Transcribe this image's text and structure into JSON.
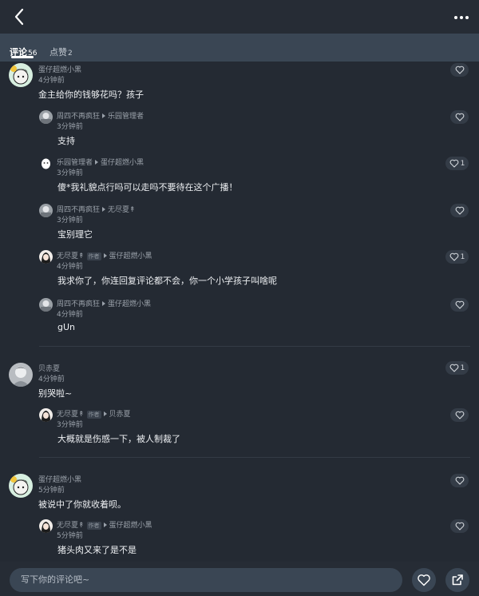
{
  "colors": {
    "background": "#242a33",
    "tab_bar": "#3a4654",
    "text_primary": "#eef0f3",
    "text_secondary": "#9aa1aa"
  },
  "header": {
    "back_icon": "chevron-left-icon",
    "more_icon": "more-dots-icon"
  },
  "tabs": [
    {
      "label": "评论",
      "count": "56",
      "active": true
    },
    {
      "label": "点赞",
      "count": "2",
      "active": false
    }
  ],
  "comments": [
    {
      "name": "蛋仔超燃小黑",
      "time": "4分钟前",
      "text": "金主给你的钱够花吗？孩子",
      "likes": ""
    },
    {
      "name": "周四不再疯狂",
      "target": "乐园管理者",
      "time": "3分钟前",
      "text": "支持",
      "likes": ""
    },
    {
      "name": "乐园管理者",
      "target": "蛋仔超燃小黑",
      "time": "3分钟前",
      "text": "傻*我礼貌点行吗可以走吗不要待在这个广播！",
      "likes": "1"
    },
    {
      "name": "周四不再疯狂",
      "target": "无尽夏↟",
      "time": "3分钟前",
      "text": "宝别理它",
      "likes": ""
    },
    {
      "name": "无尽夏↟",
      "badge": "作者",
      "target": "蛋仔超燃小黑",
      "time": "4分钟前",
      "text": "我求你了，你连回复评论都不会，你一个小学孩子叫啥呢",
      "likes": "1"
    },
    {
      "name": "周四不再疯狂",
      "target": "蛋仔超燃小黑",
      "time": "4分钟前",
      "text": "gUn",
      "likes": ""
    },
    {
      "name": "贝赤夏",
      "time": "4分钟前",
      "text": "别哭啦~",
      "likes": "1"
    },
    {
      "name": "无尽夏↟",
      "badge": "作者",
      "target": "贝赤夏",
      "time": "3分钟前",
      "text": "大概就是伤感一下，被人制裁了",
      "likes": ""
    },
    {
      "name": "蛋仔超燃小黑",
      "time": "5分钟前",
      "text": "被说中了你就收着呗。",
      "likes": ""
    },
    {
      "name": "无尽夏↟",
      "badge": "作者",
      "target": "蛋仔超燃小黑",
      "time": "5分钟前",
      "text": "猪头肉又来了是不是",
      "likes": ""
    }
  ],
  "footer": {
    "placeholder": "写下你的评论吧~",
    "like_icon": "heart-icon",
    "share_icon": "share-icon"
  }
}
